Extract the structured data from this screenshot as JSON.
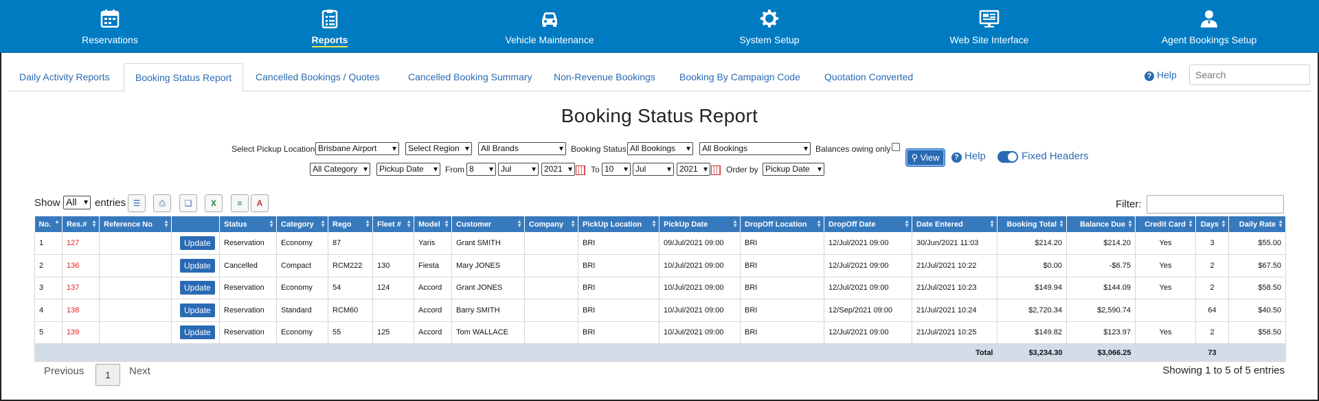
{
  "nav": [
    {
      "label": "Reservations",
      "icon": "calendar-icon"
    },
    {
      "label": "Reports",
      "icon": "clipboard-list-icon",
      "active": true
    },
    {
      "label": "Vehicle Maintenance",
      "icon": "car-icon"
    },
    {
      "label": "System Setup",
      "icon": "gear-icon"
    },
    {
      "label": "Web Site Interface",
      "icon": "monitor-icon"
    },
    {
      "label": "Agent Bookings Setup",
      "icon": "user-icon"
    }
  ],
  "tabs": [
    {
      "label": "Daily Activity Reports"
    },
    {
      "label": "Booking Status Report",
      "active": true
    },
    {
      "label": "Cancelled Bookings / Quotes"
    },
    {
      "label": "Cancelled Booking Summary"
    },
    {
      "label": "Non-Revenue Bookings"
    },
    {
      "label": "Booking By Campaign Code"
    },
    {
      "label": "Quotation Converted"
    }
  ],
  "header_help": "Help",
  "search_placeholder": "Search",
  "page_title": "Booking Status Report",
  "filters": {
    "pickup_label": "Select Pickup Location",
    "pickup_value": "Brisbane Airport",
    "region_value": "Select Region",
    "brands_value": "All Brands",
    "status_label": "Booking Status",
    "status_value": "All Bookings",
    "bookings2_value": "All Bookings",
    "balances_label": "Balances owing only",
    "category_value": "All Category",
    "datetype_value": "Pickup Date",
    "from_label": "From",
    "from_day": "8",
    "from_month": "Jul",
    "from_year": "2021",
    "to_label": "To",
    "to_day": "10",
    "to_month": "Jul",
    "to_year": "2021",
    "orderby_label": "Order by",
    "orderby_value": "Pickup Date",
    "view_label": "View",
    "help_label": "Help",
    "fixed_headers_label": "Fixed Headers"
  },
  "table_controls": {
    "show_label": "Show",
    "entries_value": "All",
    "entries_label": "entries",
    "filter_label": "Filter:"
  },
  "columns": [
    "No.",
    "Res.#",
    "Reference No",
    "",
    "Status",
    "Category",
    "Rego",
    "Fleet #",
    "Model",
    "Customer",
    "Company",
    "PickUp Location",
    "PickUp Date",
    "DropOff Location",
    "DropOff Date",
    "Date Entered",
    "Booking Total",
    "Balance Due",
    "Credit Card",
    "Days",
    "Daily Rate"
  ],
  "update_label": "Update",
  "rows": [
    {
      "no": "1",
      "res": "127",
      "ref": "",
      "status": "Reservation",
      "category": "Economy",
      "rego": "87",
      "fleet": "",
      "model": "Yaris",
      "customer": "Grant SMITH",
      "company": "",
      "pickup_loc": "BRI",
      "pickup_date": "09/Jul/2021 09:00",
      "dropoff_loc": "BRI",
      "dropoff_date": "12/Jul/2021 09:00",
      "entered": "30/Jun/2021 11:03",
      "total": "$214.20",
      "balance": "$214.20",
      "cc": "Yes",
      "days": "3",
      "rate": "$55.00"
    },
    {
      "no": "2",
      "res": "136",
      "ref": "",
      "status": "Cancelled",
      "category": "Compact",
      "rego": "RCM222",
      "fleet": "130",
      "model": "Fiesta",
      "customer": "Mary JONES",
      "company": "",
      "pickup_loc": "BRI",
      "pickup_date": "10/Jul/2021 09:00",
      "dropoff_loc": "BRI",
      "dropoff_date": "12/Jul/2021 09:00",
      "entered": "21/Jul/2021 10:22",
      "total": "$0.00",
      "balance": "-$6.75",
      "cc": "Yes",
      "days": "2",
      "rate": "$67.50"
    },
    {
      "no": "3",
      "res": "137",
      "ref": "",
      "status": "Reservation",
      "category": "Economy",
      "rego": "54",
      "fleet": "124",
      "model": "Accord",
      "customer": "Grant JONES",
      "company": "",
      "pickup_loc": "BRI",
      "pickup_date": "10/Jul/2021 09:00",
      "dropoff_loc": "BRI",
      "dropoff_date": "12/Jul/2021 09:00",
      "entered": "21/Jul/2021 10:23",
      "total": "$149.94",
      "balance": "$144.09",
      "cc": "Yes",
      "days": "2",
      "rate": "$58.50"
    },
    {
      "no": "4",
      "res": "138",
      "ref": "",
      "status": "Reservation",
      "category": "Standard",
      "rego": "RCM60",
      "fleet": "",
      "model": "Accord",
      "customer": "Barry SMITH",
      "company": "",
      "pickup_loc": "BRI",
      "pickup_date": "10/Jul/2021 09:00",
      "dropoff_loc": "BRI",
      "dropoff_date": "12/Sep/2021 09:00",
      "entered": "21/Jul/2021 10:24",
      "total": "$2,720.34",
      "balance": "$2,590.74",
      "cc": "",
      "days": "64",
      "rate": "$40.50"
    },
    {
      "no": "5",
      "res": "139",
      "ref": "",
      "status": "Reservation",
      "category": "Economy",
      "rego": "55",
      "fleet": "125",
      "model": "Accord",
      "customer": "Tom WALLACE",
      "company": "",
      "pickup_loc": "BRI",
      "pickup_date": "10/Jul/2021 09:00",
      "dropoff_loc": "BRI",
      "dropoff_date": "12/Jul/2021 09:00",
      "entered": "21/Jul/2021 10:25",
      "total": "$149.82",
      "balance": "$123.97",
      "cc": "Yes",
      "days": "2",
      "rate": "$58.50"
    }
  ],
  "totals": {
    "label": "Total",
    "total": "$3,234.30",
    "balance": "$3,066.25",
    "days": "73"
  },
  "pagination": {
    "previous": "Previous",
    "page": "1",
    "next": "Next",
    "showing": "Showing 1 to 5 of 5 entries"
  },
  "colors": {
    "nav_bg": "#007bc2",
    "accent": "#2a6ab3",
    "header_bg": "#3779bd",
    "res_link": "#e02020",
    "total_row": "#d2dde8"
  }
}
